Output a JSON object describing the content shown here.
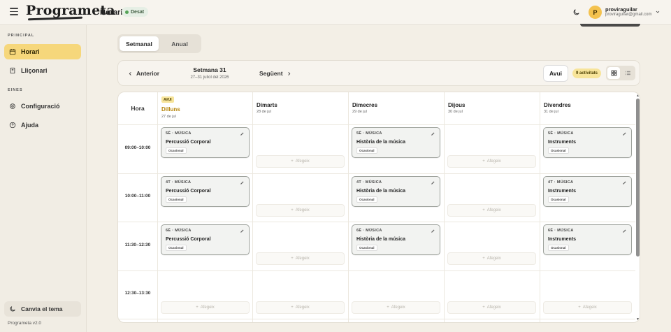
{
  "header": {
    "logo": "Programeta",
    "page": "Horari",
    "save_status": "Desat",
    "user": {
      "initial": "P",
      "name": "proviraguilar",
      "email": "proviraguilar@gmail.com"
    }
  },
  "sidebar": {
    "section_principal": "PRINCIPAL",
    "section_eines": "EINES",
    "items": [
      {
        "label": "Horari",
        "icon": "calendar-icon"
      },
      {
        "label": "Lliçonari",
        "icon": "book-icon"
      },
      {
        "label": "Configuració",
        "icon": "gear-icon"
      },
      {
        "label": "Ajuda",
        "icon": "help-icon"
      }
    ],
    "theme_button": "Canvia el tema",
    "version": "Programeta v2.0"
  },
  "view_toggle": {
    "weekly": "Setmanal",
    "annual": "Anual"
  },
  "week_nav": {
    "prev": "Anterior",
    "next": "Següent",
    "title": "Setmana 31",
    "range": "27–31 juliol del 2026",
    "today": "Avui",
    "activities": "9 activitats"
  },
  "calendar": {
    "hour_header": "Hora",
    "today_tag": "AVUI",
    "add_label": "Afegeix",
    "days": [
      {
        "name": "Dilluns",
        "date": "27 de jul"
      },
      {
        "name": "Dimarts",
        "date": "28 de jul"
      },
      {
        "name": "Dimecres",
        "date": "29 de jul"
      },
      {
        "name": "Dijous",
        "date": "30 de jul"
      },
      {
        "name": "Divendres",
        "date": "31 de jul"
      }
    ],
    "slots": [
      "09:00–10:00",
      "10:00–11:00",
      "11:30–12:30",
      "12:30–13:30"
    ],
    "lessons": [
      {
        "group": "5È · MÚSICA",
        "title": "Percussió Corporal",
        "tag": "Ocasional"
      },
      {
        "group": "5È · MÚSICA",
        "title": "Història de la música",
        "tag": "Ocasional"
      },
      {
        "group": "5È · MÚSICA",
        "title": "Instruments",
        "tag": "Ocasional"
      },
      {
        "group": "4T · MÚSICA",
        "title": "Percussió Corporal",
        "tag": "Ocasional"
      },
      {
        "group": "4T · MÚSICA",
        "title": "Història de la música",
        "tag": "Ocasional"
      },
      {
        "group": "4T · MÚSICA",
        "title": "Instruments",
        "tag": "Ocasional"
      },
      {
        "group": "6È · MÚSICA",
        "title": "Percussió Corporal",
        "tag": "Ocasional"
      },
      {
        "group": "6È · MÚSICA",
        "title": "Història de la música",
        "tag": "Ocasional"
      },
      {
        "group": "6È · MÚSICA",
        "title": "Instruments",
        "tag": "Ocasional"
      }
    ]
  }
}
